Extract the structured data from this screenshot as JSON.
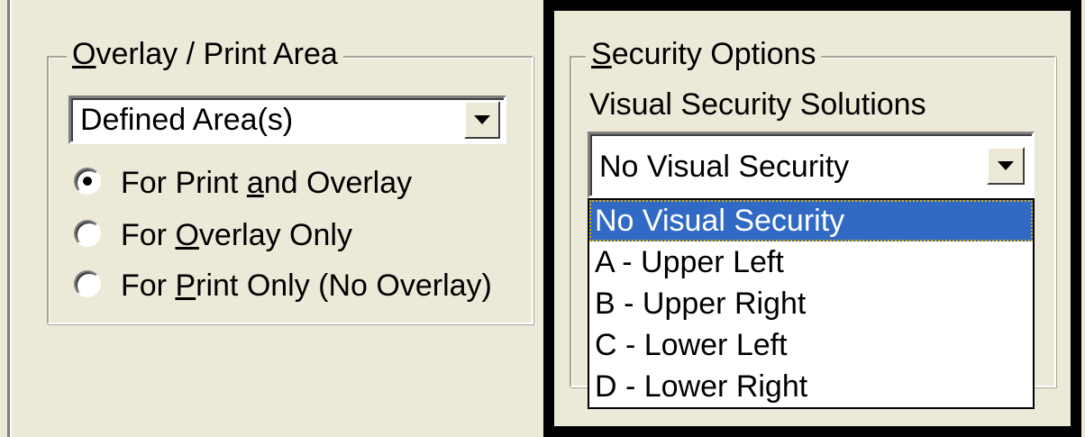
{
  "overlay_group": {
    "legend": "Overlay / Print Area",
    "combo": {
      "value": "Defined Area(s)"
    },
    "radios": [
      {
        "label": "For Print and Overlay",
        "checked": true
      },
      {
        "label": "For Overlay Only",
        "checked": false
      },
      {
        "label": "For Print Only (No Overlay)",
        "checked": false
      }
    ]
  },
  "security_group": {
    "legend": "Security Options",
    "label": "Visual Security Solutions",
    "combo": {
      "value": "No Visual Security"
    },
    "options": [
      "No Visual Security",
      "A - Upper Left",
      "B - Upper Right",
      "C - Lower Left",
      "D - Lower Right"
    ],
    "selected_index": 0
  },
  "colors": {
    "background": "#ece9d8",
    "selection": "#316ac5",
    "highlight_frame": "#000000"
  }
}
